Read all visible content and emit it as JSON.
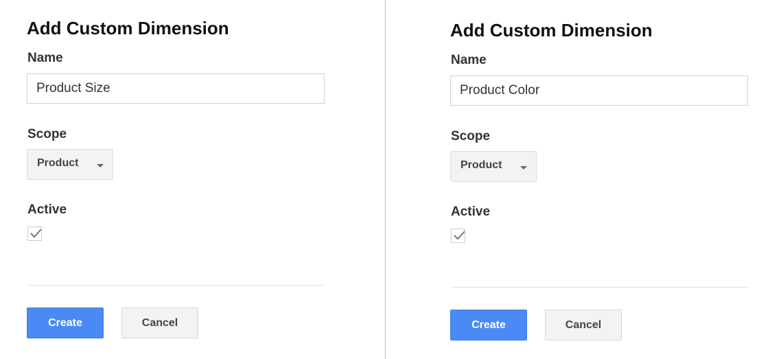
{
  "forms": [
    {
      "title": "Add Custom Dimension",
      "name_label": "Name",
      "name_value": "Product Size",
      "scope_label": "Scope",
      "scope_value": "Product",
      "active_label": "Active",
      "active_checked": true,
      "create_label": "Create",
      "cancel_label": "Cancel"
    },
    {
      "title": "Add Custom Dimension",
      "name_label": "Name",
      "name_value": "Product Color",
      "scope_label": "Scope",
      "scope_value": "Product",
      "active_label": "Active",
      "active_checked": true,
      "create_label": "Create",
      "cancel_label": "Cancel"
    }
  ],
  "colors": {
    "primary_button": "#4a8af4"
  }
}
